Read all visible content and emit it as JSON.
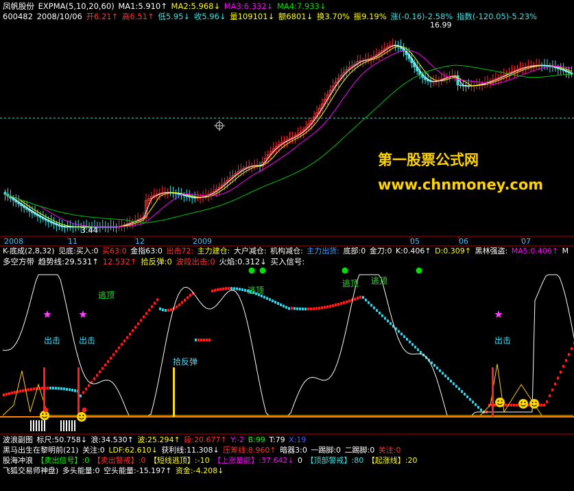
{
  "header": {
    "stock_name": "凤帆股份",
    "indicator": "EXPMA(5,10,20,60)",
    "ma1": "MA1:5.910↑",
    "ma2": "MA2:5.968↓",
    "ma3": "MA3:6.332↓",
    "ma4": "MA4:7.933↓",
    "line2": {
      "code": "600482",
      "date": "2008/10/06",
      "open": "开6.21↑",
      "high": "高6.51↑",
      "low": "低5.95↓",
      "close": "收5.96↓",
      "vol": "量109101↓",
      "amount": "额6801↓",
      "turnover": "换3.70%",
      "amplitude": "振9.19%",
      "change": "涨(-0.16)-2.58%",
      "index": "指数(-120.05)-5.23%"
    }
  },
  "price_labels": {
    "high": "16.99",
    "low": "3.44"
  },
  "watermark": {
    "line1": "第一股票公式网",
    "line2": "www.chnmoney.com"
  },
  "time_axis": [
    "2008",
    "11",
    "12",
    "2009",
    "05",
    "06",
    "07"
  ],
  "indicator_bar": [
    "K-底成(2,8,32)",
    "见底:买入:0",
    "买63:0",
    "金指63:0",
    "出击72:",
    "主力建仓:",
    "大户减仓:",
    "机构减仓:",
    "主力出货:",
    "底部:0",
    "金刀:0",
    "K:0.406↑",
    "D:0.309↑",
    "黑林强盗:",
    "MA5:0.406↑",
    "M"
  ],
  "panel2_title": [
    "多空方带",
    "趋势线:29.531↑",
    "12.532↑",
    "拾反弹:0",
    "波段出击:0",
    "火焰:0.312↓",
    "买入信号:"
  ],
  "panel2_labels": {
    "escape": "逃顶",
    "attack": "出击",
    "rebound": "拾反弹"
  },
  "bottom_lines": [
    [
      "波浪副图",
      "标尺:50.758↓",
      "浪:34.530↑",
      "波:25.294↑",
      "段:20.677↑",
      "Y:-2",
      "B:99",
      "T:79",
      "X:19"
    ],
    [
      "黑马出生在黎明前(21)",
      "关注:0",
      "LDF:62.610↓",
      "获利线:11.308↓",
      "压筹线:8.960↑",
      "暗器3:0",
      "一踢脚:0",
      "二踢脚:0",
      "关注:0"
    ],
    [
      "股海冲浪",
      "【卖出信号】:0",
      "【卖出警戒】:0",
      "【短线逃顶】:-10",
      "【上涨量能】:37.642↓",
      "0",
      "【顶部警戒】:80",
      "【起涨线】:20"
    ],
    [
      "飞狐交易师神盘)",
      "多头能量:0",
      "空头能量:-15.197↑",
      "资金:-4.208↓"
    ]
  ],
  "colors": {
    "up": "#ff3030",
    "down": "#40e0e0",
    "ma5": "#ffffff",
    "ma10": "#ffff00",
    "ma20": "#ff00ff",
    "ma60": "#00c800"
  }
}
